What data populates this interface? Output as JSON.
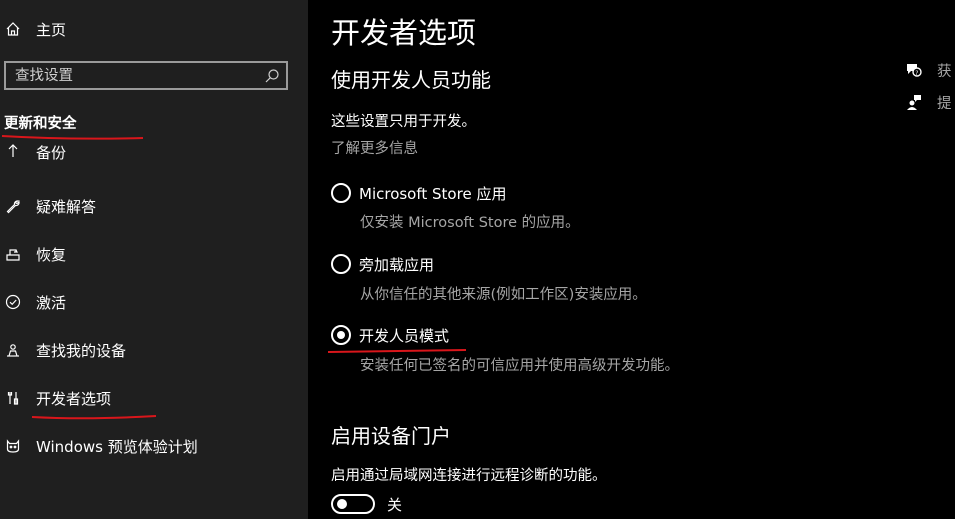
{
  "sidebar": {
    "home_label": "主页",
    "search_placeholder": "查找设置",
    "section_title": "更新和安全",
    "items": [
      {
        "label": "备份",
        "icon": "backup-icon"
      },
      {
        "label": "疑难解答",
        "icon": "wrench-icon"
      },
      {
        "label": "恢复",
        "icon": "recovery-icon"
      },
      {
        "label": "激活",
        "icon": "check-circle-icon"
      },
      {
        "label": "查找我的设备",
        "icon": "person-pin-icon"
      },
      {
        "label": "开发者选项",
        "icon": "developer-tools-icon"
      },
      {
        "label": "Windows 预览体验计划",
        "icon": "insider-cat-icon"
      }
    ]
  },
  "main": {
    "title": "开发者选项",
    "dev_section": {
      "title": "使用开发人员功能",
      "description": "这些设置只用于开发。",
      "learn_more": "了解更多信息",
      "options": [
        {
          "label": "Microsoft Store 应用",
          "desc": "仅安装 Microsoft Store 的应用。",
          "checked": false
        },
        {
          "label": "旁加载应用",
          "desc": "从你信任的其他来源(例如工作区)安装应用。",
          "checked": false
        },
        {
          "label": "开发人员模式",
          "desc": "安装任何已签名的可信应用并使用高级开发功能。",
          "checked": true
        }
      ]
    },
    "portal_section": {
      "title": "启用设备门户",
      "description": "启用通过局域网连接进行远程诊断的功能。",
      "toggle_label": "关",
      "toggle_on": false
    }
  },
  "right_panel": {
    "links": [
      {
        "label": "获",
        "icon": "help-chat-icon"
      },
      {
        "label": "提",
        "icon": "feedback-person-icon"
      }
    ]
  },
  "colors": {
    "sidebar_bg": "#1f1f1f",
    "main_bg": "#000000",
    "muted_text": "#a6a6a6",
    "annotation_red": "#d9161b"
  }
}
